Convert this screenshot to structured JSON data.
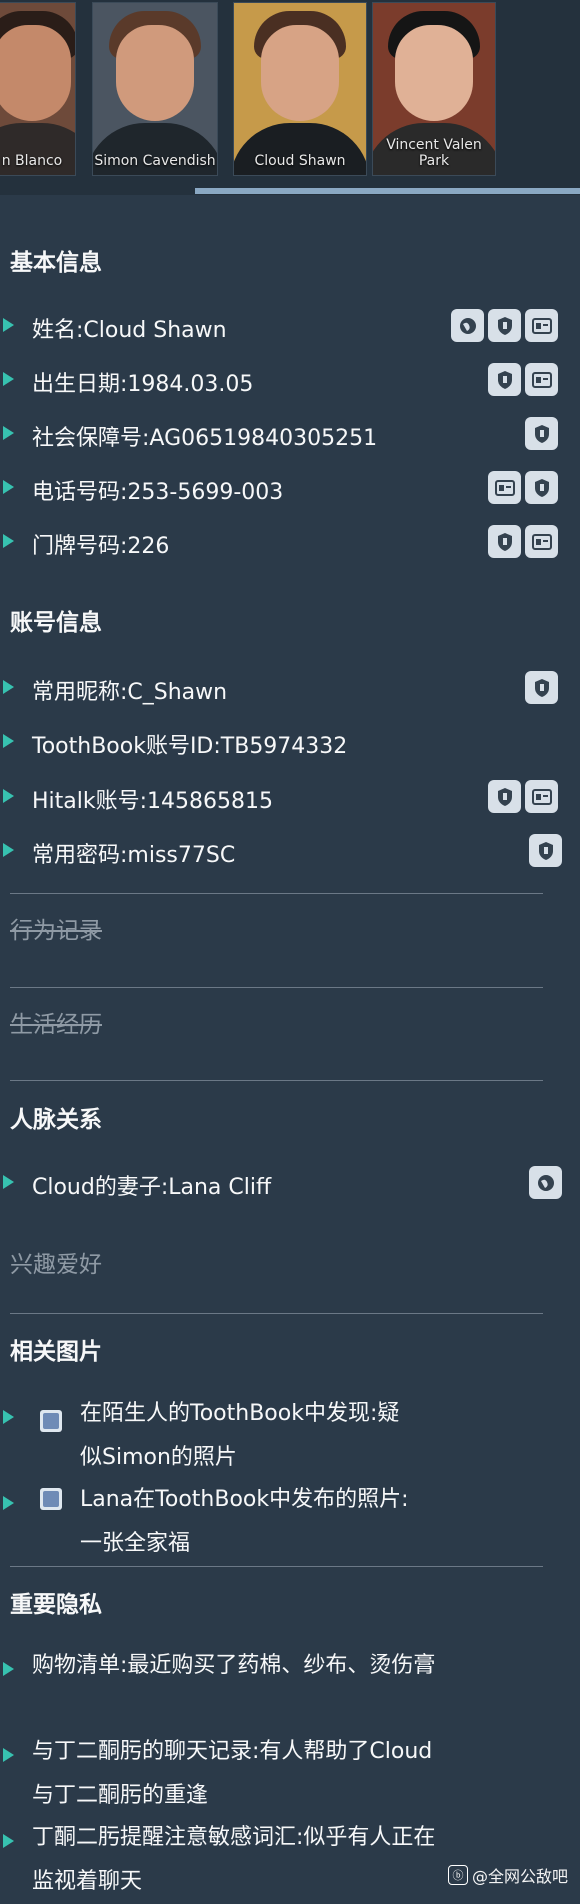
{
  "portraits": [
    {
      "name": "n Blanco"
    },
    {
      "name": "Simon Cavendish"
    },
    {
      "name": "Cloud Shawn"
    },
    {
      "name": "Vincent Valen Park"
    }
  ],
  "sections": {
    "basic": "基本信息",
    "account": "账号信息",
    "behavior": "行为记录",
    "life": "生活经历",
    "relations": "人脉关系",
    "hobbies": "兴趣爱好",
    "photos": "相关图片",
    "privacy": "重要隐私"
  },
  "basic_rows": [
    {
      "text": "姓名:Cloud Shawn",
      "icons": [
        "globe-icon",
        "shield-icon",
        "id-card-icon"
      ]
    },
    {
      "text": "出生日期:1984.03.05",
      "icons": [
        "shield-icon",
        "id-card-icon"
      ]
    },
    {
      "text": "社会保障号:AG06519840305251",
      "icons": [
        "shield-icon"
      ]
    },
    {
      "text": "电话号码:253-5699-003",
      "icons": [
        "id-card-icon",
        "shield-icon"
      ]
    },
    {
      "text": "门牌号码:226",
      "icons": [
        "shield-icon",
        "id-card-icon"
      ]
    }
  ],
  "account_rows": [
    {
      "text": "常用昵称:C_Shawn",
      "icons": [
        "shield-icon"
      ]
    },
    {
      "text": "ToothBook账号ID:TB5974332",
      "icons": []
    },
    {
      "text": "Hitalk账号:145865815",
      "icons": [
        "shield-icon",
        "id-card-icon"
      ]
    },
    {
      "text": "常用密码:miss77SC",
      "icons": [
        "shield-icon"
      ]
    }
  ],
  "relation_rows": [
    {
      "text": "Cloud的妻子:Lana Cliff",
      "icons": [
        "globe-icon"
      ]
    }
  ],
  "photo_rows": [
    {
      "text": "在陌生人的ToothBook中发现:疑似Simon的照片"
    },
    {
      "text": "Lana在ToothBook中发布的照片:一张全家福"
    }
  ],
  "privacy_rows": [
    {
      "text": "购物清单:最近购买了药棉、纱布、烫伤膏"
    },
    {
      "text": "与丁二酮肟的聊天记录:有人帮助了Cloud与丁二酮肟的重逢"
    },
    {
      "text": "丁酮二肟提醒注意敏感词汇:似乎有人正在监视着聊天"
    }
  ],
  "watermark": {
    "badge": "ⓑ",
    "text": "@全网公敌吧"
  }
}
